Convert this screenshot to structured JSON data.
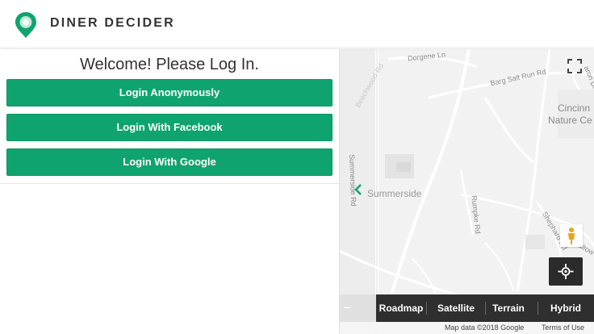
{
  "app": {
    "title": "DINER DECIDER",
    "logo_icon": "map-pin-logo-icon",
    "brand_color": "#0fa46f"
  },
  "login": {
    "heading": "Welcome! Please Log In.",
    "buttons": [
      {
        "label": "Login Anonymously"
      },
      {
        "label": "Login With Facebook"
      },
      {
        "label": "Login With Google"
      }
    ]
  },
  "map": {
    "labels": {
      "dorgene": "Dorgene Ln",
      "barg": "Barg Salt Run Rd",
      "cincinnati1": "Cincinn",
      "cincinnati2": "Nature Ce",
      "beechwood": "Beechwood Rd",
      "summerside_rd": "Summerside Rd",
      "summerside": "Summerside",
      "rumpke": "Rumpke Rd",
      "shephard": "Shephard Rd",
      "tealtown": "Tealtow",
      "aaron": "aron Dr",
      "ville": "lle"
    },
    "controls": {
      "zoom_out_label": "−",
      "map_types": [
        "Roadmap",
        "Satellite",
        "Terrain",
        "Hybrid"
      ]
    },
    "attribution": {
      "data": "Map data ©2018 Google",
      "terms": "Terms of Use"
    }
  }
}
